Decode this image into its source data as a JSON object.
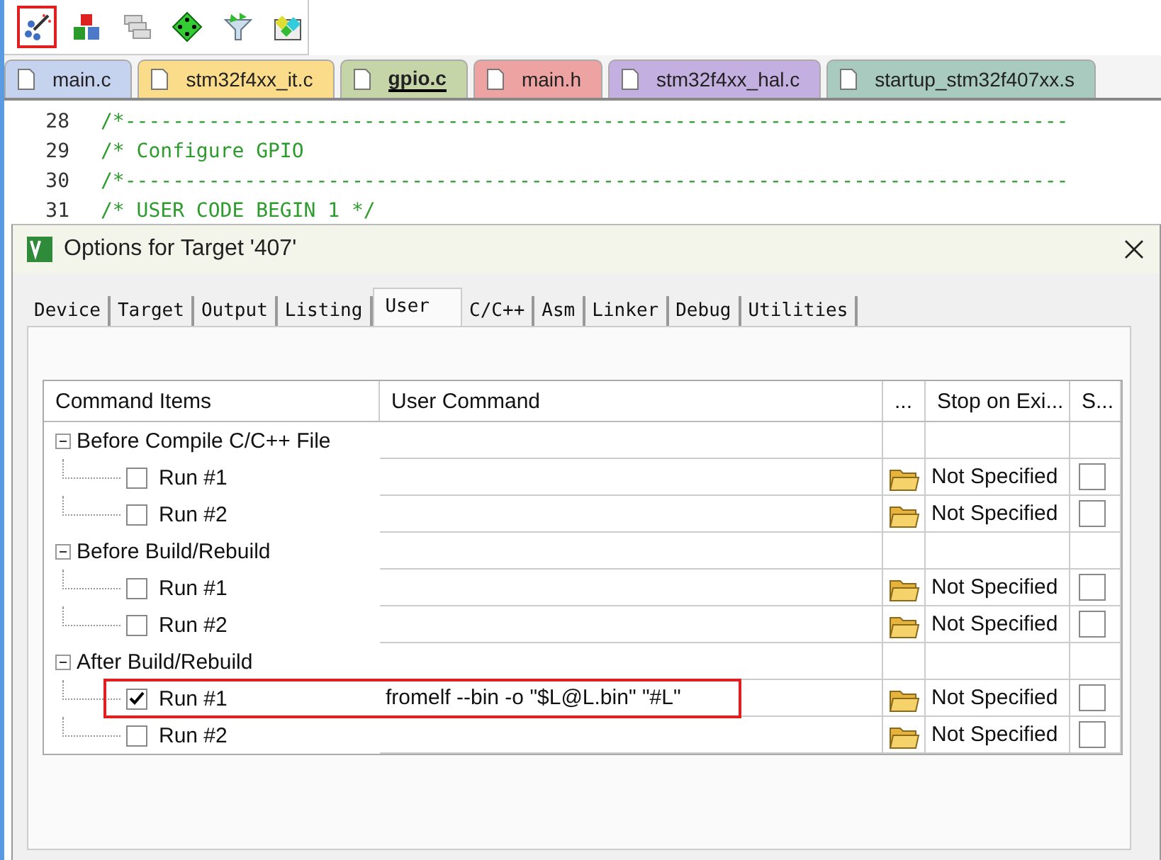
{
  "toolbar": [
    {
      "kind": "wizard",
      "highlighted": true
    },
    {
      "kind": "components",
      "highlighted": false
    },
    {
      "kind": "stack",
      "highlighted": false
    },
    {
      "kind": "diamond",
      "highlighted": false
    },
    {
      "kind": "funnel",
      "highlighted": false
    },
    {
      "kind": "packs",
      "highlighted": false
    }
  ],
  "file_tabs": [
    {
      "label": "main.c",
      "color": "#c5d3ee",
      "selected": false
    },
    {
      "label": "stm32f4xx_it.c",
      "color": "#fbdc8a",
      "selected": false
    },
    {
      "label": "gpio.c",
      "color": "#c6d5a8",
      "selected": true
    },
    {
      "label": "main.h",
      "color": "#eea3a3",
      "selected": false
    },
    {
      "label": "stm32f4xx_hal.c",
      "color": "#c3b0e0",
      "selected": false
    },
    {
      "label": "startup_stm32f407xx.s",
      "color": "#a9cbbf",
      "selected": false
    }
  ],
  "editor": {
    "lines": [
      {
        "number": "28",
        "text": "/*-------------------------------------------------------------------------------"
      },
      {
        "number": "29",
        "text": "/* Configure GPIO"
      },
      {
        "number": "30",
        "text": "/*-------------------------------------------------------------------------------"
      },
      {
        "number": "31",
        "text": "/* USER CODE BEGIN 1 */"
      }
    ]
  },
  "dialog": {
    "title": "Options for Target '407'",
    "tabs": [
      {
        "label": "Device",
        "selected": false
      },
      {
        "label": "Target",
        "selected": false
      },
      {
        "label": "Output",
        "selected": false
      },
      {
        "label": "Listing",
        "selected": false
      },
      {
        "label": "User",
        "selected": true
      },
      {
        "label": "C/C++",
        "selected": false
      },
      {
        "label": "Asm",
        "selected": false
      },
      {
        "label": "Linker",
        "selected": false
      },
      {
        "label": "Debug",
        "selected": false
      },
      {
        "label": "Utilities",
        "selected": false
      }
    ],
    "table": {
      "columns": [
        "Command Items",
        "User Command",
        "...",
        "Stop on Exi...",
        "S..."
      ],
      "groups": [
        {
          "label": "Before Compile C/C++ File",
          "expanded": true,
          "children": [
            {
              "label": "Run #1",
              "checked": false,
              "stop": "Not Specified",
              "s_checked": false,
              "highlighted": false
            },
            {
              "label": "Run #2",
              "checked": false,
              "stop": "Not Specified",
              "s_checked": false,
              "highlighted": false
            }
          ]
        },
        {
          "label": "Before Build/Rebuild",
          "expanded": true,
          "children": [
            {
              "label": "Run #1",
              "checked": false,
              "stop": "Not Specified",
              "s_checked": false,
              "highlighted": false
            },
            {
              "label": "Run #2",
              "checked": false,
              "stop": "Not Specified",
              "s_checked": false,
              "highlighted": false
            }
          ]
        },
        {
          "label": "After Build/Rebuild",
          "expanded": true,
          "children": [
            {
              "label": "Run #1",
              "checked": true,
              "command": "fromelf --bin -o \"$L@L.bin\" \"#L\"",
              "stop": "Not Specified",
              "s_checked": false,
              "highlighted": true
            },
            {
              "label": "Run #2",
              "checked": false,
              "stop": "Not Specified",
              "s_checked": false,
              "highlighted": false
            }
          ]
        }
      ]
    }
  }
}
